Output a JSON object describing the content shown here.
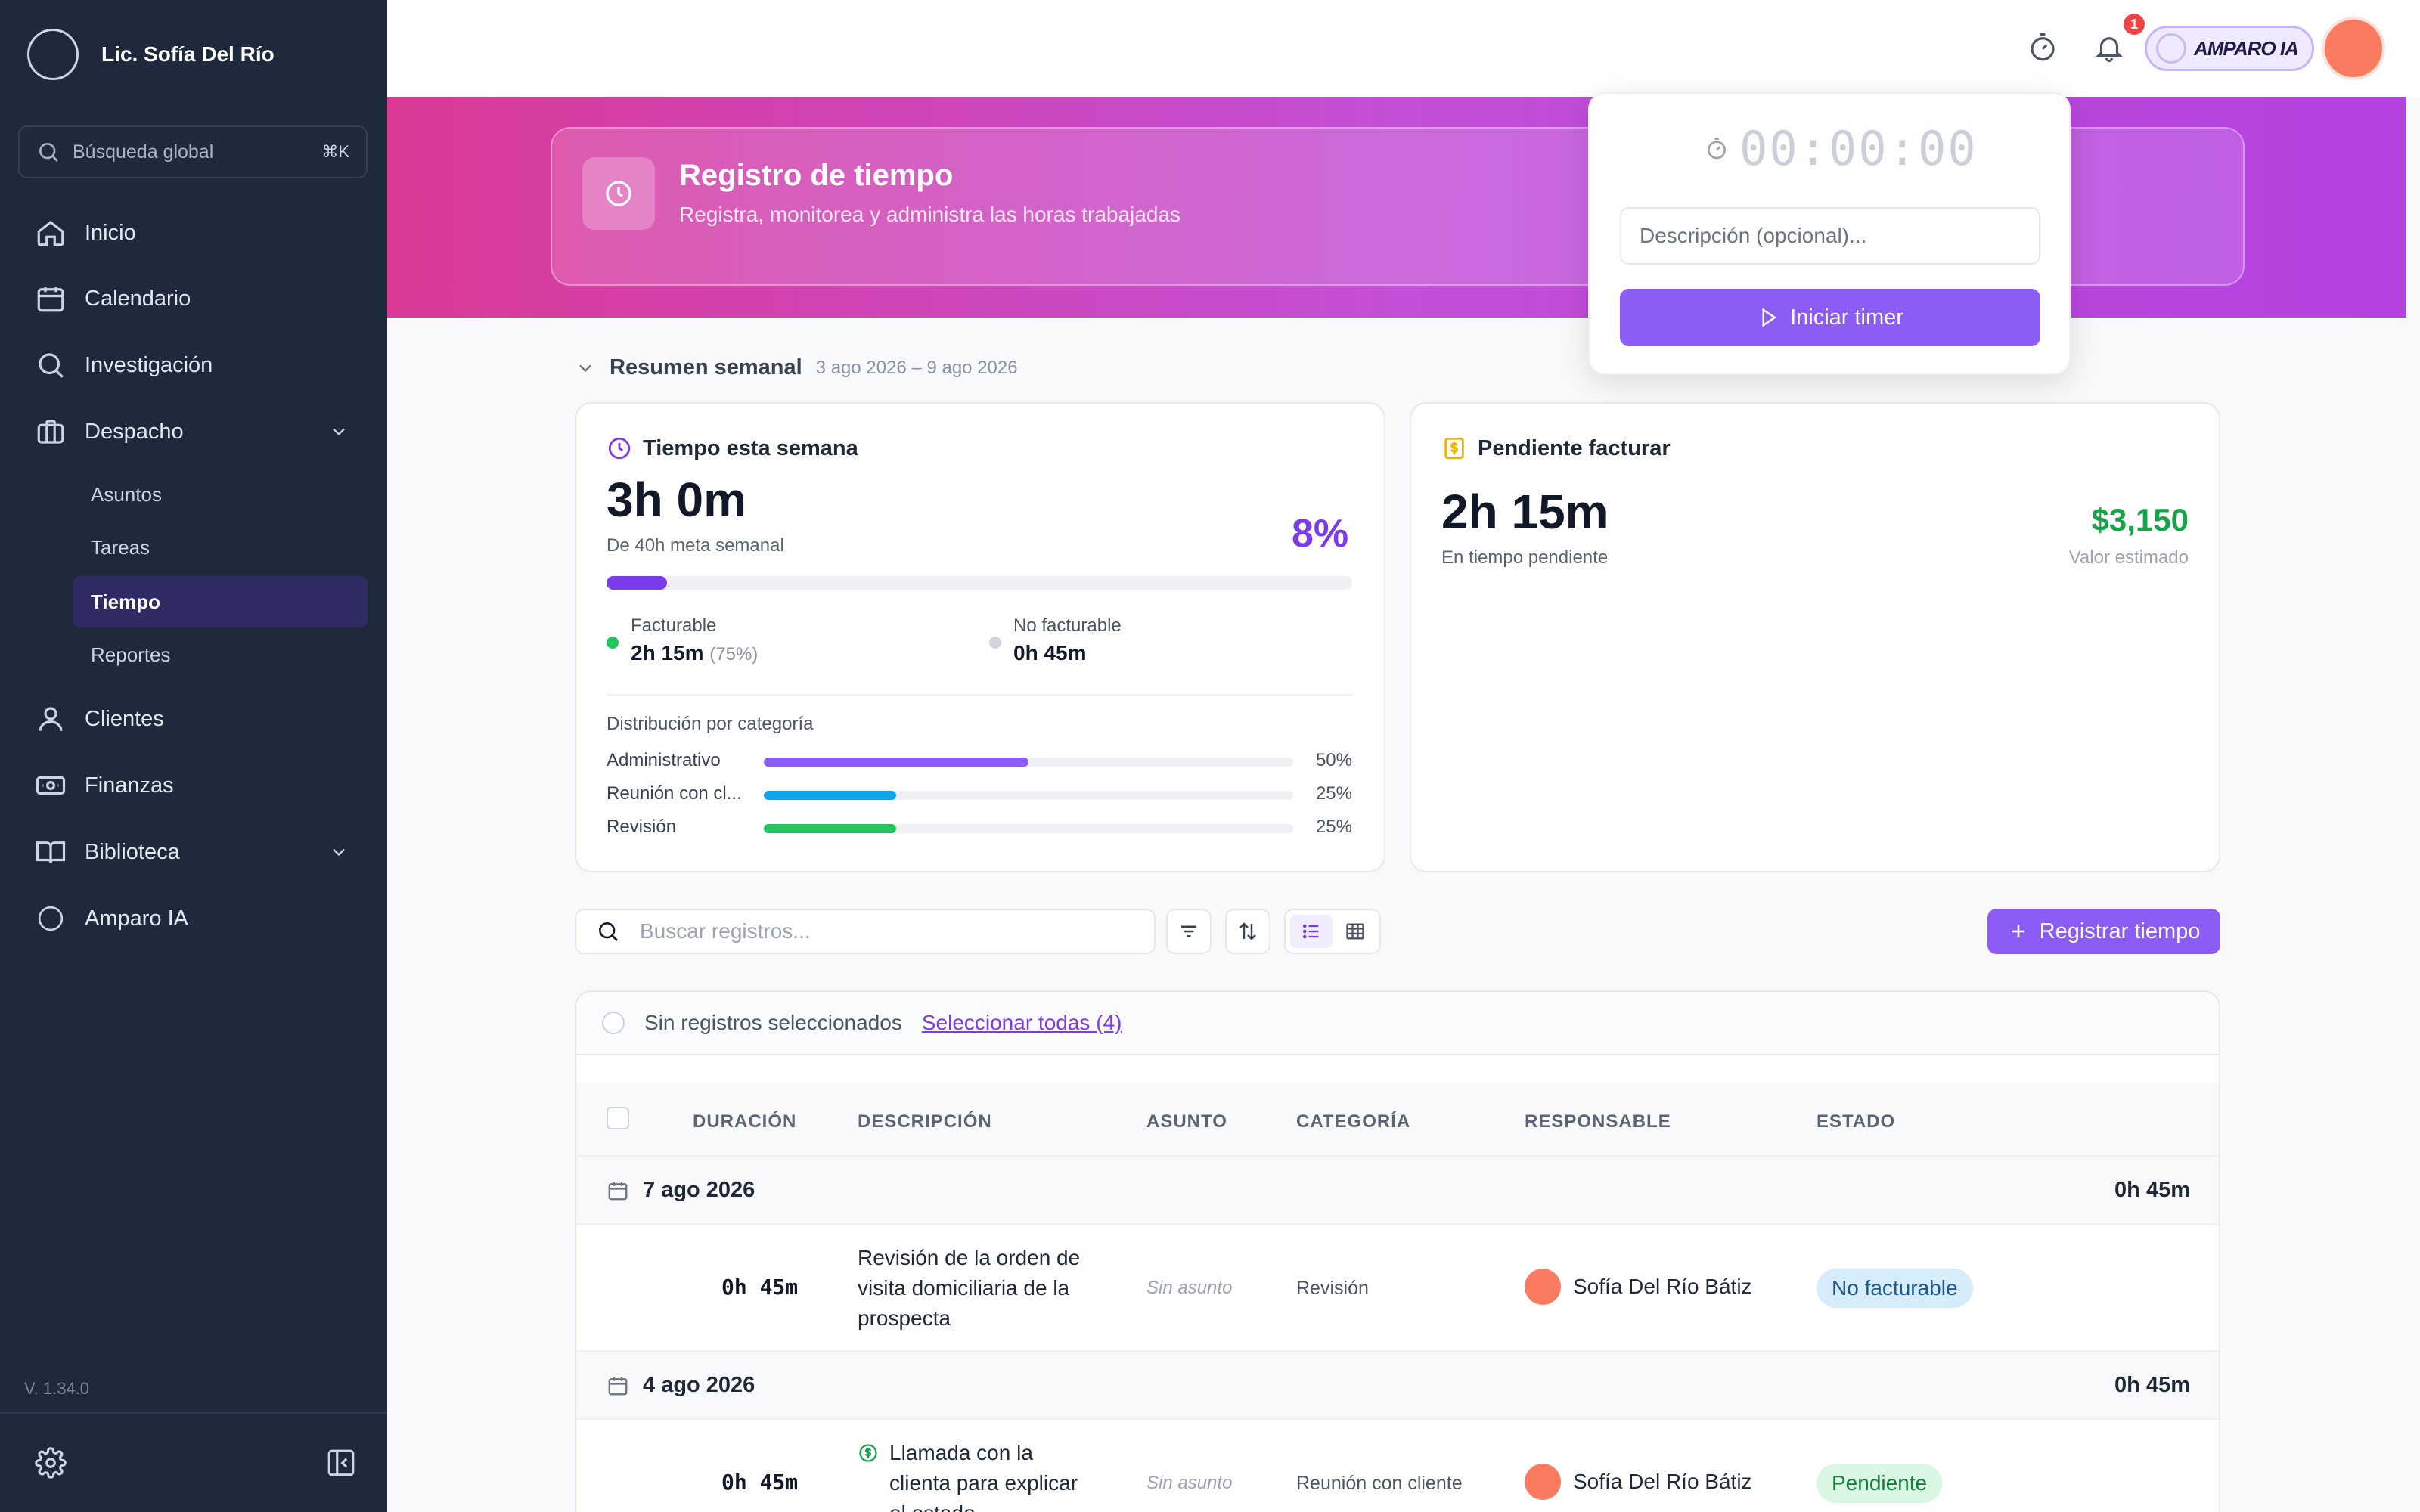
{
  "sidebar": {
    "user_name": "Lic. Sofía Del Río",
    "search_label": "Búsqueda global",
    "search_shortcut": "⌘K",
    "items": [
      {
        "label": "Inicio",
        "icon": "home-icon"
      },
      {
        "label": "Calendario",
        "icon": "calendar-icon"
      },
      {
        "label": "Investigación",
        "icon": "search-icon"
      },
      {
        "label": "Despacho",
        "icon": "briefcase-icon"
      },
      {
        "label": "Clientes",
        "icon": "user-icon"
      },
      {
        "label": "Finanzas",
        "icon": "money-icon"
      },
      {
        "label": "Biblioteca",
        "icon": "book-icon"
      },
      {
        "label": "Amparo IA",
        "icon": "amparo-icon"
      }
    ],
    "despacho_sub": [
      "Asuntos",
      "Tareas",
      "Tiempo",
      "Reportes"
    ],
    "active_sub": "Tiempo",
    "version": "V. 1.34.0"
  },
  "topbar": {
    "notification_count": "1",
    "amparo_label": "AMPARO IA"
  },
  "hero": {
    "title": "Registro de tiempo",
    "subtitle": "Registra, monitorea y administra las horas trabajadas"
  },
  "timer": {
    "display": "00:00:00",
    "description_placeholder": "Descripción (opcional)...",
    "start_label": "Iniciar timer"
  },
  "summary": {
    "title": "Resumen semanal",
    "range": "3 ago 2026 – 9 ago 2026",
    "week": {
      "title": "Tiempo esta semana",
      "total": "3h 0m",
      "goal": "De 40h meta semanal",
      "percent": "8%",
      "progress": 0.08,
      "billable_label": "Facturable",
      "billable_value": "2h 15m",
      "billable_pct": "(75%)",
      "nonbillable_label": "No facturable",
      "nonbillable_value": "0h 45m",
      "dist_title": "Distribución por categoría",
      "categories": [
        {
          "name": "Administrativo",
          "pct": "50%",
          "value": 0.5,
          "color": "#8b5cf6"
        },
        {
          "name": "Reunión con cl...",
          "pct": "25%",
          "value": 0.25,
          "color": "#0ea5e9"
        },
        {
          "name": "Revisión",
          "pct": "25%",
          "value": 0.25,
          "color": "#22c55e"
        }
      ]
    },
    "pending": {
      "title": "Pendiente facturar",
      "total": "2h 15m",
      "sub": "En tiempo pendiente",
      "money": "$3,150",
      "money_label": "Valor estimado"
    }
  },
  "toolbar": {
    "search_placeholder": "Buscar registros...",
    "register_label": "Registrar tiempo"
  },
  "table": {
    "select_text": "Sin registros seleccionados",
    "select_all": "Seleccionar todas (4)",
    "headers": [
      "DURACIÓN",
      "DESCRIPCIÓN",
      "ASUNTO",
      "CATEGORÍA",
      "RESPONSABLE",
      "ESTADO"
    ],
    "groups": [
      {
        "date": "7 ago 2026",
        "total": "0h 45m",
        "row": {
          "duration": "0h 45m",
          "description": "Revisión de la orden de visita domiciliaria de la prospecta",
          "asunto": "Sin asunto",
          "category": "Revisión",
          "responsible": "Sofía Del Río Bátiz",
          "status": "No facturable"
        }
      },
      {
        "date": "4 ago 2026",
        "total": "0h 45m",
        "row": {
          "duration": "0h 45m",
          "description": "Llamada con la clienta para explicar el estado...",
          "asunto": "Sin asunto",
          "category": "Reunión con cliente",
          "responsible": "Sofía Del Río Bátiz",
          "status": "Pendiente"
        }
      }
    ]
  }
}
